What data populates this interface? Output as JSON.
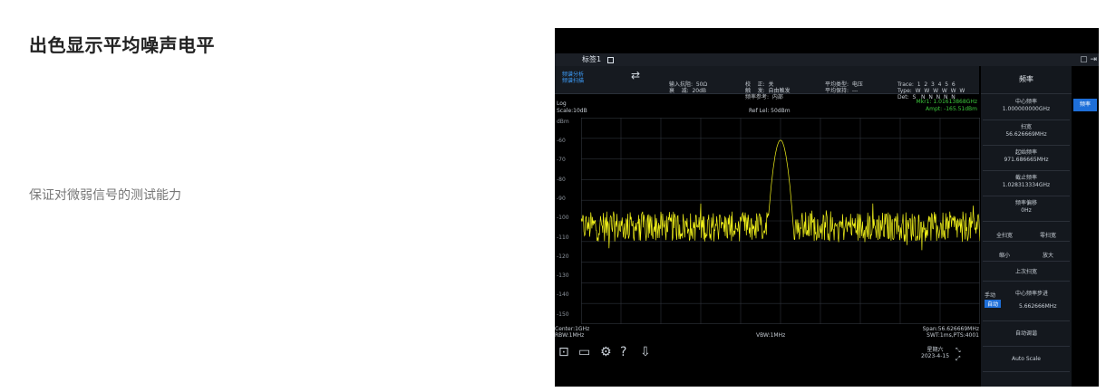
{
  "left": {
    "title": "出色显示平均噪声电平",
    "subtitle": "保证对微弱信号的测试能力"
  },
  "device": {
    "tab": "标签1",
    "mode": [
      "频谱分析",
      "频谱扫描"
    ],
    "input": [
      "输入抗阻:  50Ω",
      "衰    减:  20dB"
    ],
    "trig": [
      "校    正:  关",
      "触    发:  自由触发",
      "频率参考:  内部"
    ],
    "avg": [
      "平均类型:  电压",
      "平均保持:  ---"
    ],
    "trace": [
      "Trace:  1  2  3  4  5  6",
      "Type:  W  W  W  W  W  W",
      "Det:  S   N  N  N  N  N"
    ],
    "scale": [
      "Log",
      "Scale:10dB"
    ],
    "ref_lvl": "Ref Lel: 50dBm",
    "marker": [
      "Mkr1:       1.01613868GHz",
      "Ampt:           -165.51dBm"
    ],
    "y_unit": "dBm",
    "y_ticks": [
      "-60",
      "-70",
      "-80",
      "-90",
      "-100",
      "-110",
      "-120",
      "-130",
      "-140",
      "-150"
    ],
    "bottom": {
      "center": "Center:1GHz",
      "rbw": "RBW:1MHz",
      "vbw": "VBW:1MHz",
      "span": "Span:56.626669MHz",
      "swt": "SWT:1ms,PTS:4001"
    },
    "date": [
      "星期六",
      "2023-4-15"
    ],
    "right": {
      "header": "频率",
      "side_tab": "频率",
      "center_freq": [
        "中心频率",
        "1.000000000GHz"
      ],
      "span": [
        "扫宽",
        "56.626669MHz"
      ],
      "start": [
        "起始频率",
        "971.686665MHz"
      ],
      "stop": [
        "截止频率",
        "1.028313334GHz"
      ],
      "offset": [
        "频率偏移",
        "0Hz"
      ],
      "full_span": "全扫宽",
      "zero_span": "零扫宽",
      "zoom_out": "缩小",
      "zoom_in": "放大",
      "last_span": "上次扫宽",
      "step_manual": "手动",
      "step_auto": "自动",
      "step_label": "中心频率步进",
      "step_value": "5.662666MHz",
      "auto_tune": "自动调谐",
      "auto_scale": "Auto Scale"
    }
  },
  "chart_data": {
    "type": "line",
    "x_range": [
      971.686665,
      1028.313334
    ],
    "ylim": [
      -160,
      -50
    ],
    "noise_floor": -108,
    "peak": {
      "x": 1000.0,
      "y": -62
    },
    "color": "#f2f21a"
  }
}
